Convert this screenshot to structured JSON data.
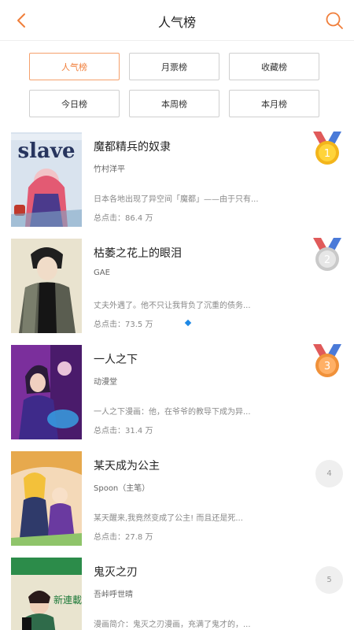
{
  "header": {
    "title": "人气榜",
    "back_icon": "chevron-left-icon",
    "search_icon": "search-icon",
    "accent": "#f07e3a"
  },
  "tabs": [
    {
      "label": "人气榜",
      "active": true
    },
    {
      "label": "月票榜",
      "active": false
    },
    {
      "label": "收藏榜",
      "active": false
    },
    {
      "label": "今日榜",
      "active": false
    },
    {
      "label": "本周榜",
      "active": false
    },
    {
      "label": "本月榜",
      "active": false
    }
  ],
  "items": [
    {
      "title": "魔都精兵的奴隶",
      "author": "竹村洋平",
      "desc": "日本各地出现了异空间「魔都」——由于只有...",
      "clicks": "总点击：86.4 万",
      "rank": "1",
      "medal": "gold",
      "cover_text": "slave"
    },
    {
      "title": "枯萎之花上的眼泪",
      "author": "GAE",
      "desc": "丈夫外遇了。他不只让我背负了沉重的债务...",
      "clicks": "总点击：73.5 万",
      "rank": "2",
      "medal": "silver"
    },
    {
      "title": "一人之下",
      "author": "动漫堂",
      "desc": "一人之下漫画：他，在爷爷的教导下成为异...",
      "clicks": "总点击：31.4 万",
      "rank": "3",
      "medal": "bronze"
    },
    {
      "title": "某天成为公主",
      "author": "Spoon（主笔）",
      "desc": "某天醒来,我竟然变成了公主! 而且还是死...",
      "clicks": "总点击：27.8 万",
      "rank": "4"
    },
    {
      "title": "鬼灭之刃",
      "author": "吾峠呼世晴",
      "desc": "漫画简介：鬼灭之刃漫画，充满了鬼才的，...",
      "clicks": "",
      "rank": "5",
      "cover_text": "新連載"
    }
  ]
}
